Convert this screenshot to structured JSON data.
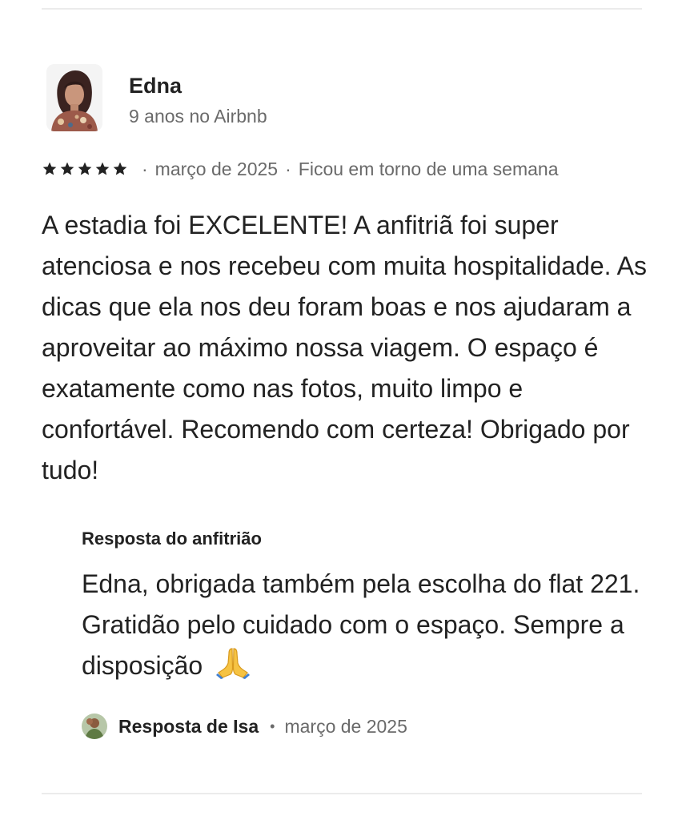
{
  "reviewer": {
    "name": "Edna",
    "tenure": "9 anos no Airbnb"
  },
  "rating": {
    "stars": 5,
    "date": "março de 2025",
    "stay_length": "Ficou em torno de uma semana",
    "star_color": "#222222"
  },
  "review": {
    "text": "A estadia foi EXCELENTE! A anfitriã foi super atenciosa e nos recebeu com muita hospitalidade. As dicas que ela nos deu foram boas e nos ajudaram a aproveitar ao máximo nossa viagem. O espaço é exatamente como nas fotos, muito limpo e confortável. Recomendo com certeza! Obrigado por tudo!"
  },
  "host_response": {
    "title": "Resposta do anfitrião",
    "text": "Edna, obrigada também pela escolha do flat 221. Gratidão pelo cuidado com o espaço. Sempre a disposição",
    "emoji_icon": "praying-hands-icon",
    "responder_label": "Resposta de Isa",
    "date": "março de 2025"
  },
  "colors": {
    "text_primary": "#222222",
    "text_secondary": "#6a6a6a",
    "divider": "#ebebeb"
  }
}
